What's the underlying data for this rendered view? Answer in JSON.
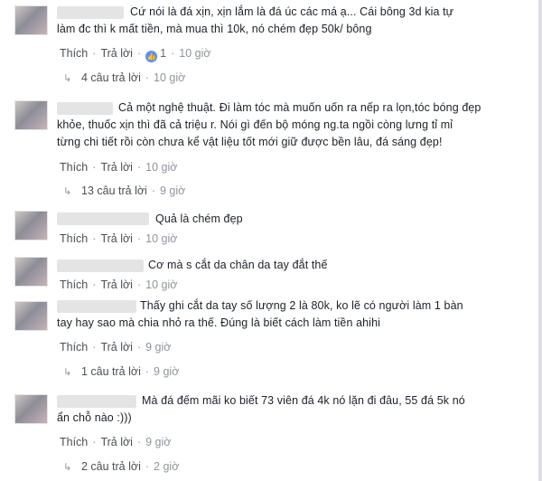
{
  "comments": [
    {
      "text": "Cứ nói là đá xịn, xịn lắm là đá úc các má ạ... Cái bông 3d kia tự\nlàm đc thì k mất tiền, mà mua thì 10k, nó chém đẹp 50k/ bông",
      "like": "Thích",
      "reply": "Trả lời",
      "reactions": "1",
      "time": "10 giờ",
      "replies_label": "4 câu trả lời",
      "replies_time": "10 giờ"
    },
    {
      "text": "Cả một nghệ thuật. Đi làm tóc mà muốn uốn ra nếp ra lọn,tóc bóng đẹp\nkhỏe, thuốc xịn thì đã cả triệu r. Nói gì đến bộ móng ng.ta ngồi còng lưng tỉ mỉ\ntừng chi tiết rồi còn chưa kể vật liệu tốt mới giữ được bền lâu, đá sáng đẹp!",
      "like": "Thích",
      "reply": "Trả lời",
      "time": "10 giờ",
      "replies_label": "13 câu trả lời",
      "replies_time": "9 giờ"
    },
    {
      "text": "Quả là chém đẹp",
      "like": "Thích",
      "reply": "Trả lời",
      "time": "10 giờ"
    },
    {
      "text": "Cơ mà s cắt da chân da tay đắt thế",
      "like": "Thích",
      "reply": "Trả lời",
      "time": "10 giờ"
    },
    {
      "text": "Thấy ghi cắt da tay số lượng 2 là 80k, ko lẽ có người làm 1 bàn\ntay hay sao mà chia nhỏ ra thế. Đúng là biết cách làm tiền ahihi",
      "like": "Thích",
      "reply": "Trả lời",
      "time": "9 giờ",
      "replies_label": "1 câu trả lời",
      "replies_time": "9 giờ"
    },
    {
      "text": "Mà đá đếm mãi ko biết 73 viên đá 4k nó lặn đi đâu, 55 đá 5k nó\nẩn chỗ nào :)))",
      "like": "Thích",
      "reply": "Trả lời",
      "time": "9 giờ",
      "replies_label": "2 câu trả lời",
      "replies_time": "2 giờ"
    }
  ],
  "icons": {
    "like_badge": "like-icon",
    "reply_arrow": "reply-arrow-icon"
  },
  "colors": {
    "link": "#4b4f56",
    "meta": "#90949c",
    "like_badge": "#5890ff"
  }
}
